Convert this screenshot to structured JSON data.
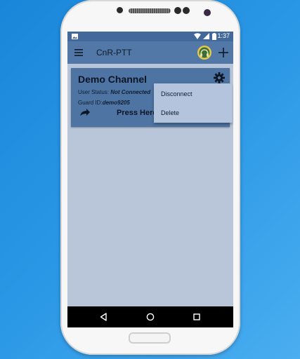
{
  "status_bar": {
    "time": "1:37"
  },
  "app_bar": {
    "title": "CnR-PTT"
  },
  "channel_card": {
    "name": "Demo Channel",
    "user_status_label": "User Status: ",
    "user_status_value": "Not Connected",
    "guard_id_label": "Guard ID:",
    "guard_id_value": "demo9205",
    "press_here": "Press Here"
  },
  "context_menu": {
    "items": [
      "Disconnect",
      "Delete"
    ]
  },
  "colors": {
    "app_bar": "#5278a7",
    "status_bar": "#43699a",
    "card": "#4e74a4",
    "screen_bg": "#b9c5d9"
  }
}
